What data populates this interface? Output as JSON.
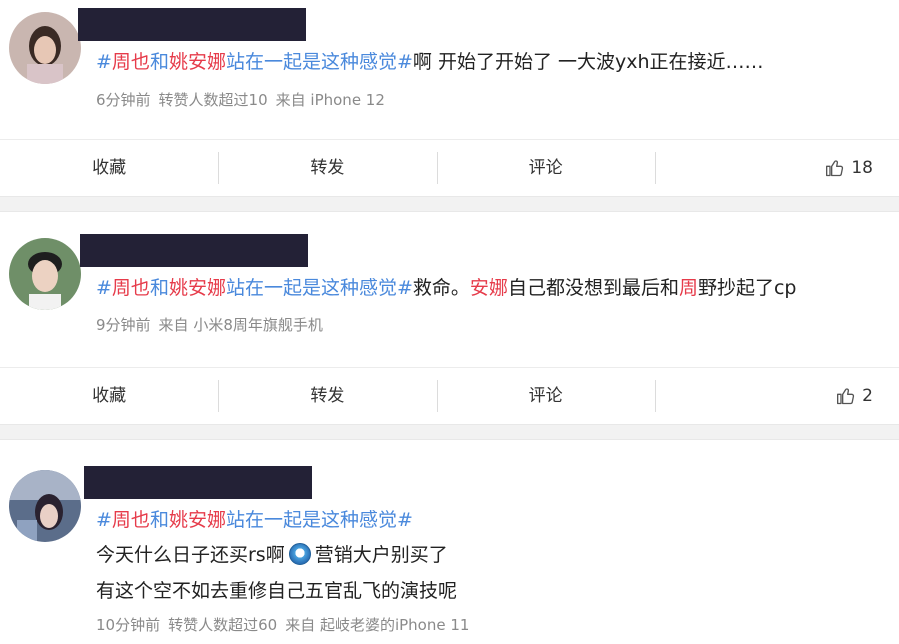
{
  "posts": [
    {
      "hashtag": {
        "open": "#",
        "name_a": "周也",
        "connector": "和",
        "name_b": "姚安娜",
        "rest": "站在一起是这种感觉",
        "close": "#"
      },
      "text": "啊 开始了开始了 一大波yxh正在接近……",
      "meta": {
        "time": "6分钟前",
        "reposts": "转赞人数超过10",
        "source": "来自 iPhone 12"
      },
      "actions": {
        "collect": "收藏",
        "repost": "转发",
        "comment": "评论",
        "likes": "18"
      }
    },
    {
      "hashtag": {
        "open": "#",
        "name_a": "周也",
        "connector": "和",
        "name_b": "姚安娜",
        "rest": "站在一起是这种感觉",
        "close": "#"
      },
      "text_parts": [
        "救命。",
        "安娜",
        "自己都没想到最后和",
        "周",
        "野抄起了cp"
      ],
      "meta": {
        "time": "9分钟前",
        "source": "来自 小米8周年旗舰手机"
      },
      "actions": {
        "collect": "收藏",
        "repost": "转发",
        "comment": "评论",
        "likes": "2"
      }
    },
    {
      "hashtag": {
        "open": "#",
        "name_a": "周也",
        "connector": "和",
        "name_b": "姚安娜",
        "rest": "站在一起是这种感觉",
        "close": "#"
      },
      "line1_a": "今天什么日子还买rs啊",
      "line1_b": "营销大户别买了",
      "line2": "有这个空不如去重修自己五官乱飞的演技呢",
      "meta": {
        "time": "10分钟前",
        "reposts": "转赞人数超过60",
        "source": "来自 起岐老婆的iPhone 11"
      }
    }
  ],
  "colors": {
    "hashtag": "#4a89dc",
    "highlight": "#e63b4a",
    "redaction": "#232136"
  }
}
